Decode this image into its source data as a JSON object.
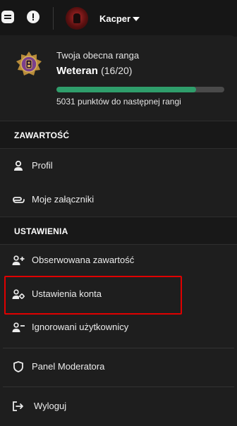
{
  "topbar": {
    "username": "Kacper",
    "icons": {
      "menu": "menu-icon",
      "alert": "alert-icon",
      "avatar": "avatar",
      "caret": "caret-down-icon"
    }
  },
  "rank": {
    "subtitle": "Twoja obecna ranga",
    "name": "Weteran",
    "progress_text": "(16/20)",
    "progress_fraction": 0.83,
    "points_text": "5031 punktów do następnej rangi",
    "colors": {
      "bar_fill": "#2f9e6b",
      "bar_track": "#4a4a4a"
    }
  },
  "sections": {
    "content": "ZAWARTOŚĆ",
    "settings": "USTAWIENIA"
  },
  "menu": {
    "profile": "Profil",
    "attachments": "Moje załączniki",
    "followed": "Obserwowana zawartość",
    "account_settings": "Ustawienia konta",
    "ignored_users": "Ignorowani użytkownicy",
    "moderator_panel": "Panel Moderatora",
    "logout": "Wyloguj"
  },
  "highlight_color": "#e00000"
}
